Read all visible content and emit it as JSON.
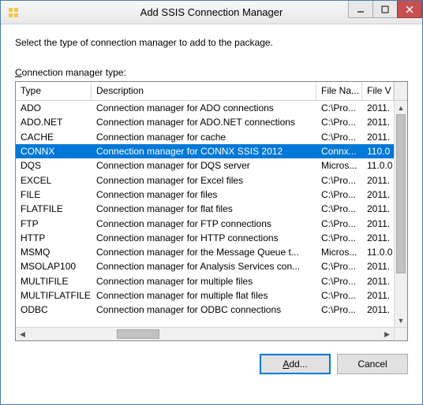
{
  "window": {
    "title": "Add SSIS Connection Manager"
  },
  "instruction": "Select the type of connection manager to add to the package.",
  "list_label_pre": "C",
  "list_label_rest": "onnection manager type:",
  "columns": {
    "type": "Type",
    "description": "Description",
    "filename": "File Na...",
    "filever": "File V"
  },
  "rows": [
    {
      "type": "ADO",
      "desc": "Connection manager for ADO connections",
      "file": "C:\\Pro...",
      "ver": "2011.",
      "selected": false
    },
    {
      "type": "ADO.NET",
      "desc": "Connection manager for ADO.NET connections",
      "file": "C:\\Pro...",
      "ver": "2011.",
      "selected": false
    },
    {
      "type": "CACHE",
      "desc": "Connection manager for cache",
      "file": "C:\\Pro...",
      "ver": "2011.",
      "selected": false
    },
    {
      "type": "CONNX",
      "desc": "Connection manager for CONNX SSIS 2012",
      "file": "Connx...",
      "ver": "110.0",
      "selected": true
    },
    {
      "type": "DQS",
      "desc": "Connection manager for DQS server",
      "file": "Micros...",
      "ver": "11.0.0",
      "selected": false
    },
    {
      "type": "EXCEL",
      "desc": "Connection manager for Excel files",
      "file": "C:\\Pro...",
      "ver": "2011.",
      "selected": false
    },
    {
      "type": "FILE",
      "desc": "Connection manager for files",
      "file": "C:\\Pro...",
      "ver": "2011.",
      "selected": false
    },
    {
      "type": "FLATFILE",
      "desc": "Connection manager for flat files",
      "file": "C:\\Pro...",
      "ver": "2011.",
      "selected": false
    },
    {
      "type": "FTP",
      "desc": "Connection manager for FTP connections",
      "file": "C:\\Pro...",
      "ver": "2011.",
      "selected": false
    },
    {
      "type": "HTTP",
      "desc": "Connection manager for HTTP connections",
      "file": "C:\\Pro...",
      "ver": "2011.",
      "selected": false
    },
    {
      "type": "MSMQ",
      "desc": "Connection manager for the Message Queue t...",
      "file": "Micros...",
      "ver": "11.0.0",
      "selected": false
    },
    {
      "type": "MSOLAP100",
      "desc": "Connection manager for Analysis Services con...",
      "file": "C:\\Pro...",
      "ver": "2011.",
      "selected": false
    },
    {
      "type": "MULTIFILE",
      "desc": "Connection manager for multiple files",
      "file": "C:\\Pro...",
      "ver": "2011.",
      "selected": false
    },
    {
      "type": "MULTIFLATFILE",
      "desc": "Connection manager for multiple flat files",
      "file": "C:\\Pro...",
      "ver": "2011.",
      "selected": false
    },
    {
      "type": "ODBC",
      "desc": "Connection manager for ODBC connections",
      "file": "C:\\Pro...",
      "ver": "2011.",
      "selected": false
    }
  ],
  "buttons": {
    "add_pre": "A",
    "add_rest": "dd...",
    "cancel": "Cancel"
  }
}
